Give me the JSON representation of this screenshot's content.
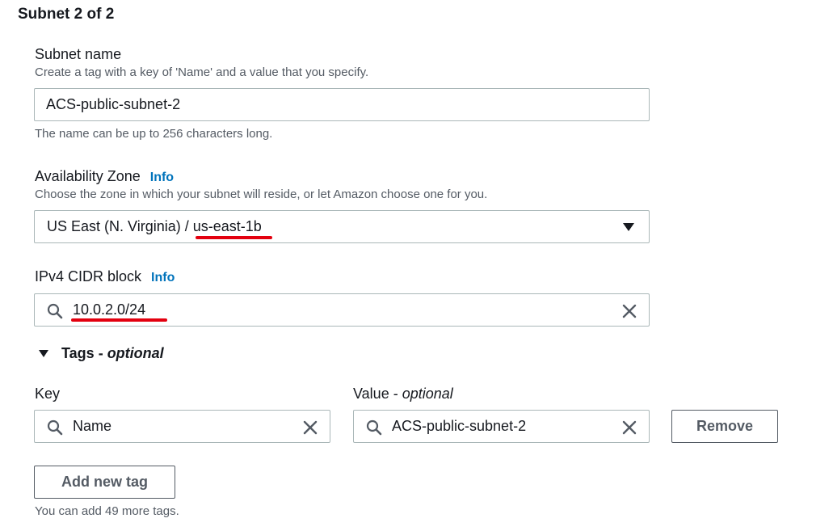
{
  "section": {
    "title": "Subnet 2 of 2"
  },
  "subnet_name": {
    "label": "Subnet name",
    "description": "Create a tag with a key of 'Name' and a value that you specify.",
    "value": "ACS-public-subnet-2",
    "constraint": "The name can be up to 256 characters long."
  },
  "availability_zone": {
    "label": "Availability Zone",
    "info": "Info",
    "description": "Choose the zone in which your subnet will reside, or let Amazon choose one for you.",
    "selected_prefix": "US East (N. Virginia) / ",
    "selected_zone": "us-east-1b"
  },
  "ipv4_cidr": {
    "label": "IPv4 CIDR block",
    "info": "Info",
    "value": "10.0.2.0/24"
  },
  "tags": {
    "toggle_label": "Tags",
    "toggle_suffix": "optional",
    "key_label": "Key",
    "value_label": "Value",
    "value_label_suffix": "optional",
    "rows": [
      {
        "key": "Name",
        "value": "ACS-public-subnet-2",
        "remove_label": "Remove"
      }
    ],
    "add_label": "Add new tag",
    "remaining_note": "You can add 49 more tags."
  },
  "annotation_color": "#e3000f"
}
